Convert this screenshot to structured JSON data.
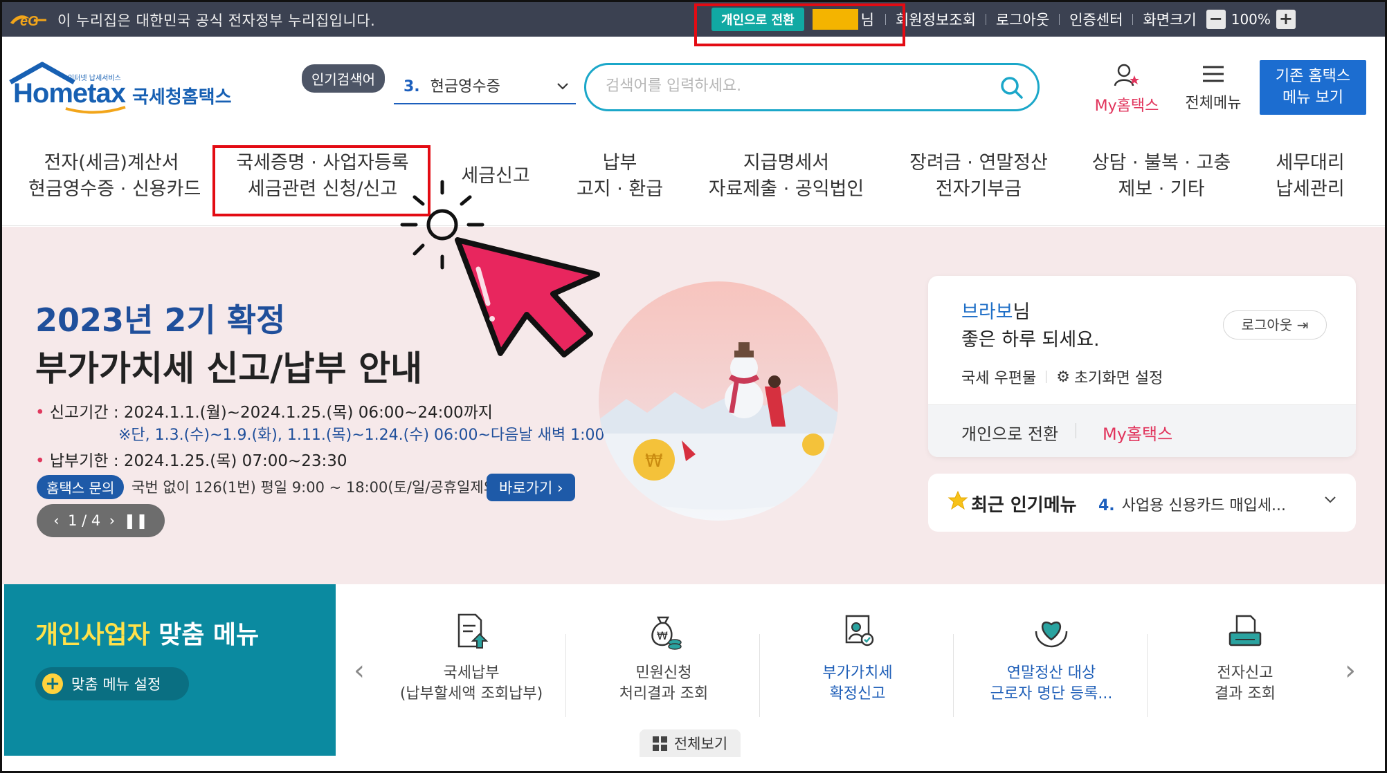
{
  "topbar": {
    "gov_text": "이 누리집은 대한민국 공식 전자정부 누리집입니다.",
    "switch_label": "개인으로 전환",
    "nim": "님",
    "links": [
      "회원정보조회",
      "로그아웃",
      "인증센터",
      "화면크기"
    ],
    "zoom_minus": "−",
    "zoom_value": "100%",
    "zoom_plus": "+"
  },
  "header": {
    "logo_small": "인터넷 납세서비스",
    "logo_main": "Hometax",
    "logo_kor": "국세청홈택스",
    "popular_badge": "인기검색어",
    "popular_num": "3.",
    "popular_term": "현금영수증",
    "search_placeholder": "검색어를 입력하세요.",
    "my_hometax": "My홈택스",
    "all_menu": "전체메뉴",
    "old_menu_line1": "기존 홈택스",
    "old_menu_line2": "메뉴 보기"
  },
  "gnb": [
    {
      "l1": "전자(세금)계산서",
      "l2": "현금영수증 · 신용카드"
    },
    {
      "l1": "국세증명 · 사업자등록",
      "l2": "세금관련 신청/신고"
    },
    {
      "l1": "세금신고",
      "l2": ""
    },
    {
      "l1": "납부",
      "l2": "고지 · 환급"
    },
    {
      "l1": "지급명세서",
      "l2": "자료제출 · 공익법인"
    },
    {
      "l1": "장려금 · 연말정산",
      "l2": "전자기부금"
    },
    {
      "l1": "상담 · 불복 · 고충",
      "l2": "제보 · 기타"
    },
    {
      "l1": "세무대리",
      "l2": "납세관리"
    }
  ],
  "hero": {
    "title1": "2023년 2기 확정",
    "title2": "부가가치세 신고/납부 안내",
    "line1": "신고기간 : 2024.1.1.(월)~2024.1.25.(목) 06:00~24:00까지",
    "note": "※단, 1.3.(수)~1.9.(화), 1.11.(목)~1.24.(수) 06:00~다음날 새벽 1:00",
    "line2": "납부기한 : 2024.1.25.(목) 07:00~23:30",
    "qna_badge": "홈택스 문의",
    "qna_text": "국번 없이 126(1번) 평일 9:00 ~ 18:00(토/일/공휴일제외)",
    "go_label": "바로가기",
    "pager": "1 / 4"
  },
  "user_card": {
    "name": "브라보",
    "name_suffix": "님",
    "greeting": "좋은 하루 되세요.",
    "logout": "로그아웃",
    "mail": "국세 우편물",
    "reset": "초기화면 설정",
    "switch_personal": "개인으로 전환",
    "my_hometax": "My홈택스"
  },
  "recent": {
    "title": "최근 인기메뉴",
    "num": "4.",
    "item": "사업용 신용카드 매입세..."
  },
  "biz": {
    "title_yellow": "개인사업자",
    "title_white": "맞춤 메뉴",
    "setting": "맞춤 메뉴 설정"
  },
  "quick_menu": [
    {
      "l1": "국세납부",
      "l2": "(납부할세액 조회납부)",
      "blue": false
    },
    {
      "l1": "민원신청",
      "l2": "처리결과 조회",
      "blue": false
    },
    {
      "l1": "부가가치세",
      "l2": "확정신고",
      "blue": true
    },
    {
      "l1": "연말정산 대상",
      "l2": "근로자 명단 등록...",
      "blue": true
    },
    {
      "l1": "전자신고",
      "l2": "결과 조회",
      "blue": false
    }
  ],
  "view_all": "전체보기",
  "colors": {
    "topbar": "#3b4151",
    "accent_teal": "#11a9a3",
    "brand_blue": "#1760b3",
    "highlight_red": "#e30b13",
    "cursor_pink": "#e8265e",
    "hero_bg": "#f6e9ea",
    "biz_teal": "#0b8aa0"
  }
}
